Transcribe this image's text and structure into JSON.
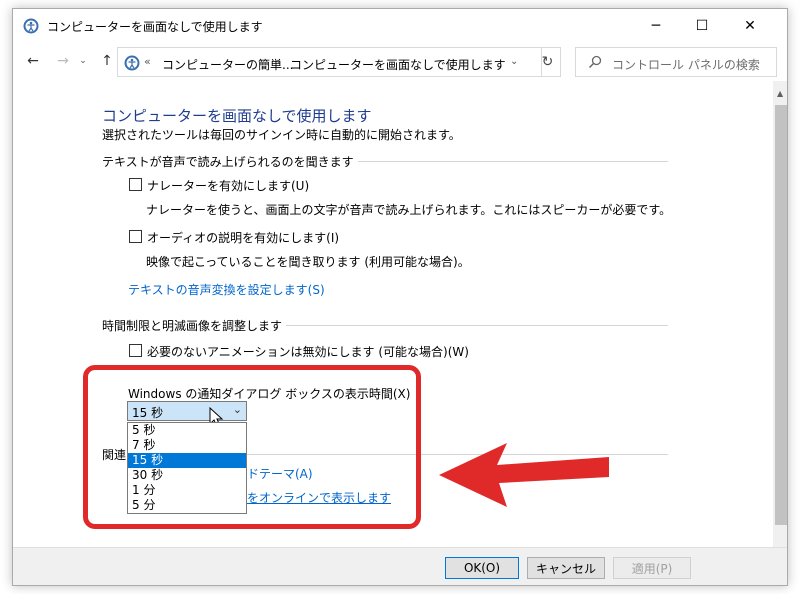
{
  "window": {
    "title": "コンピューターを画面なしで使用します",
    "controls": {
      "minimize": "─",
      "maximize": "☐",
      "close": "✕"
    }
  },
  "nav": {
    "back": "←",
    "forward": "→",
    "recent": "⌄",
    "up": "↑",
    "address": {
      "prefix": "«",
      "crumb1": "コンピューターの簡単...",
      "separator": "›",
      "crumb2": "コンピューターを画面なしで使用します",
      "dropdown": "⌄"
    },
    "refresh": "↻",
    "search_placeholder": "コントロール パネルの検索"
  },
  "main": {
    "title": "コンピューターを画面なしで使用します",
    "subtitle": "選択されたツールは毎回のサインイン時に自動的に開始されます。",
    "section1": {
      "heading": "テキストが音声で読み上げられるのを聞きます",
      "narrator_label": "ナレーターを有効にします(U)",
      "narrator_desc": "ナレーターを使うと、画面上の文字が音声で読み上げられます。これにはスピーカーが必要です。",
      "audio_label": "オーディオの説明を有効にします(I)",
      "audio_desc": "映像で起こっていることを聞き取ります (利用可能な場合)。",
      "tts_link": "テキストの音声変換を設定します(S)"
    },
    "section2": {
      "heading": "時間制限と明滅画像を調整します",
      "animation_label": "必要のないアニメーションは無効にします (可能な場合)(W)",
      "combo_label": "Windows の通知ダイアログ ボックスの表示時間(X)",
      "combo_value": "15 秒",
      "combo_arrow": "⌄",
      "options": [
        "5 秒",
        "7 秒",
        "15 秒",
        "30 秒",
        "1 分",
        "5 分"
      ],
      "selected_index": 2
    },
    "related": {
      "heading": "関連",
      "link1": "ドテーマ(A)",
      "link2": "をオンラインで表示します"
    }
  },
  "footer": {
    "ok": "OK(O)",
    "cancel": "キャンセル",
    "apply": "適用(P)"
  },
  "colors": {
    "title_blue": "#1e3d8f",
    "link_blue": "#0066cc",
    "selection_blue": "#0078d7",
    "callout_red": "#e02a2a"
  }
}
